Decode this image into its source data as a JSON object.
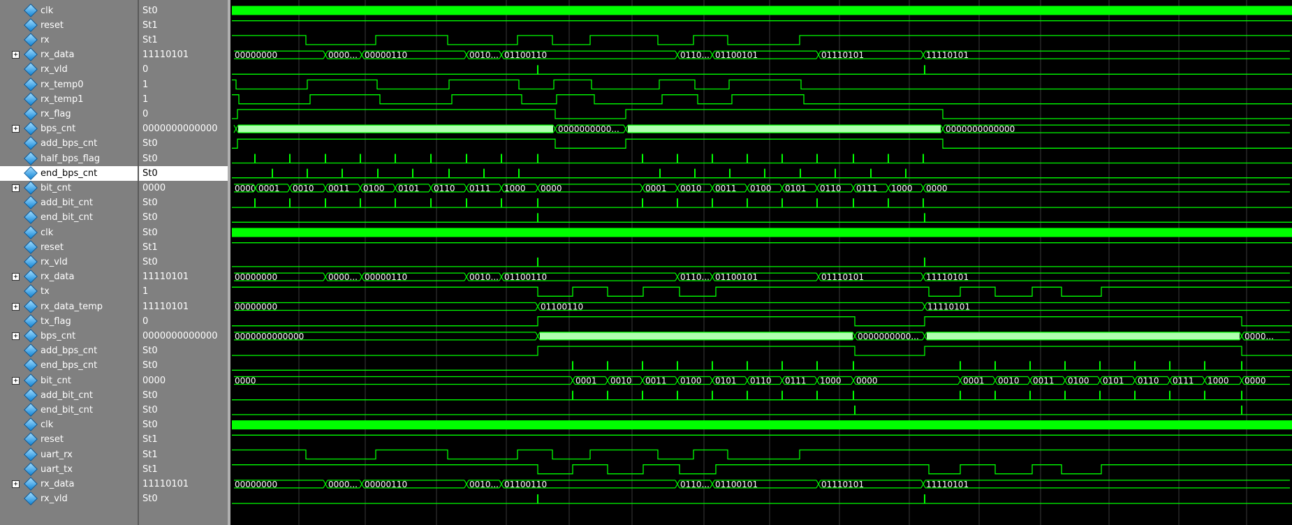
{
  "colors": {
    "wave": "#00ff00",
    "bus_fill": "#b0ffb0",
    "grid": "#3a3a3a",
    "panel": "#808080",
    "selected_row": "#ffffff"
  },
  "signals": [
    {
      "name": "clk",
      "value": "St0",
      "expandable": false
    },
    {
      "name": "reset",
      "value": "St1",
      "expandable": false
    },
    {
      "name": "rx",
      "value": "St1",
      "expandable": false
    },
    {
      "name": "rx_data",
      "value": "11110101",
      "expandable": true
    },
    {
      "name": "rx_vld",
      "value": "0",
      "expandable": false
    },
    {
      "name": "rx_temp0",
      "value": "1",
      "expandable": false
    },
    {
      "name": "rx_temp1",
      "value": "1",
      "expandable": false
    },
    {
      "name": "rx_flag",
      "value": "0",
      "expandable": false
    },
    {
      "name": "bps_cnt",
      "value": "0000000000000",
      "expandable": true
    },
    {
      "name": "add_bps_cnt",
      "value": "St0",
      "expandable": false
    },
    {
      "name": "half_bps_flag",
      "value": "St0",
      "expandable": false
    },
    {
      "name": "end_bps_cnt",
      "value": "St0",
      "expandable": false,
      "selected": true
    },
    {
      "name": "bit_cnt",
      "value": "0000",
      "expandable": true
    },
    {
      "name": "add_bit_cnt",
      "value": "St0",
      "expandable": false
    },
    {
      "name": "end_bit_cnt",
      "value": "St0",
      "expandable": false
    },
    {
      "name": "clk",
      "value": "St0",
      "expandable": false
    },
    {
      "name": "reset",
      "value": "St1",
      "expandable": false
    },
    {
      "name": "rx_vld",
      "value": "St0",
      "expandable": false
    },
    {
      "name": "rx_data",
      "value": "11110101",
      "expandable": true
    },
    {
      "name": "tx",
      "value": "1",
      "expandable": false
    },
    {
      "name": "rx_data_temp",
      "value": "11110101",
      "expandable": true
    },
    {
      "name": "tx_flag",
      "value": "0",
      "expandable": false
    },
    {
      "name": "bps_cnt",
      "value": "0000000000000",
      "expandable": true
    },
    {
      "name": "add_bps_cnt",
      "value": "St0",
      "expandable": false
    },
    {
      "name": "end_bps_cnt",
      "value": "St0",
      "expandable": false
    },
    {
      "name": "bit_cnt",
      "value": "0000",
      "expandable": true
    },
    {
      "name": "add_bit_cnt",
      "value": "St0",
      "expandable": false
    },
    {
      "name": "end_bit_cnt",
      "value": "St0",
      "expandable": false
    },
    {
      "name": "clk",
      "value": "St0",
      "expandable": false
    },
    {
      "name": "reset",
      "value": "St1",
      "expandable": false
    },
    {
      "name": "uart_rx",
      "value": "St1",
      "expandable": false
    },
    {
      "name": "uart_tx",
      "value": "St1",
      "expandable": false
    },
    {
      "name": "rx_data",
      "value": "11110101",
      "expandable": true
    },
    {
      "name": "rx_vld",
      "value": "St0",
      "expandable": false
    }
  ],
  "bus_labels": {
    "rx_data": [
      "00000000",
      "0000...",
      "00000110",
      "0010...",
      "01100110",
      "0110...",
      "01100101",
      "01110101",
      "11110101"
    ],
    "bps_cnt_rx": [
      "0000000000...",
      "0000000000000"
    ],
    "bit_cnt_rx": [
      "0000",
      "0001",
      "0010",
      "0011",
      "0100",
      "0101",
      "0110",
      "0111",
      "1000",
      "0000",
      "0001",
      "0010",
      "0011",
      "0100",
      "0101",
      "0110",
      "0111",
      "1000",
      "0000"
    ],
    "rx_data_temp": [
      "00000000",
      "01100110",
      "11110101"
    ],
    "bps_cnt_tx": [
      "0000000000000",
      "0000000000...",
      "0000..."
    ],
    "bit_cnt_tx": [
      "0000",
      "0001",
      "0010",
      "0011",
      "0100",
      "0101",
      "0110",
      "0111",
      "1000",
      "0000",
      "0001",
      "0010",
      "0011",
      "0100",
      "0101",
      "0110",
      "0111",
      "1000",
      "0000"
    ]
  }
}
